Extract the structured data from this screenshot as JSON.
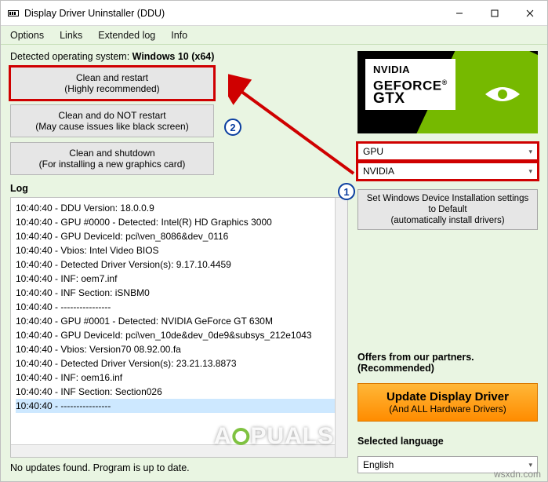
{
  "window": {
    "title": "Display Driver Uninstaller (DDU)"
  },
  "menu": {
    "options": "Options",
    "links": "Links",
    "extended": "Extended log",
    "info": "Info"
  },
  "detected_os": {
    "prefix": "Detected operating system: ",
    "value": "Windows 10 (x64)"
  },
  "actions": {
    "restart": {
      "line1": "Clean and restart",
      "line2": "(Highly recommended)"
    },
    "norestart": {
      "line1": "Clean and do NOT restart",
      "line2": "(May cause issues like black screen)"
    },
    "shutdown": {
      "line1": "Clean and shutdown",
      "line2": "(For installing a new graphics card)"
    }
  },
  "log": {
    "label": "Log",
    "lines": [
      "10:40:40 - DDU Version: 18.0.0.9",
      "10:40:40 - GPU #0000 - Detected: Intel(R) HD Graphics 3000",
      "10:40:40 - GPU DeviceId: pci\\ven_8086&dev_0116",
      "10:40:40 - Vbios: Intel Video BIOS",
      "10:40:40 - Detected Driver Version(s): 9.17.10.4459",
      "10:40:40 - INF: oem7.inf",
      "10:40:40 - INF Section: iSNBM0",
      "10:40:40 - ----------------",
      "10:40:40 - GPU #0001 - Detected: NVIDIA GeForce GT 630M",
      "10:40:40 - GPU DeviceId: pci\\ven_10de&dev_0de9&subsys_212e1043",
      "10:40:40 - Vbios: Version70 08.92.00.fa",
      "10:40:40 - Detected Driver Version(s): 23.21.13.8873",
      "10:40:40 - INF: oem16.inf",
      "10:40:40 - INF Section: Section026",
      "10:40:40 - ----------------"
    ]
  },
  "status": "No updates found. Program is up to date.",
  "gtx": {
    "brand1": "NVIDIA",
    "brand2": "GEFORCE",
    "brand3": "GTX"
  },
  "selectors": {
    "device_type": "GPU",
    "vendor": "NVIDIA"
  },
  "devset": {
    "line1": "Set Windows Device Installation settings",
    "line2": "to Default",
    "line3": "(automatically install drivers)"
  },
  "offers": {
    "label": "Offers from our partners. (Recommended)",
    "btn1": "Update Display Driver",
    "btn2": "(And ALL Hardware Drivers)"
  },
  "lang": {
    "label": "Selected language",
    "value": "English"
  },
  "watermark": {
    "a": "A",
    "b": "PUALS"
  },
  "domain": "wsxdn.com"
}
